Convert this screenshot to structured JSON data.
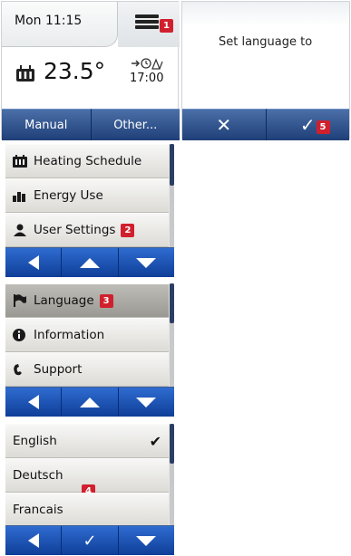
{
  "home": {
    "clock": "Mon 11:15",
    "temperature": "23.5°",
    "next_time": "17:00",
    "badge": "1",
    "buttons": [
      "Manual",
      "Other..."
    ]
  },
  "set_language": {
    "prompt": "Set language to",
    "cancel_symbol": "✕",
    "confirm_symbol": "✓",
    "badge": "5"
  },
  "main_menu": {
    "items": [
      {
        "label": "Heating Schedule",
        "icon": "calendar-icon"
      },
      {
        "label": "Energy Use",
        "icon": "bar-chart-icon"
      },
      {
        "label": "User Settings",
        "icon": "user-icon",
        "badge": "2"
      }
    ]
  },
  "settings_menu": {
    "items": [
      {
        "label": "Language",
        "icon": "flag-icon",
        "badge": "3"
      },
      {
        "label": "Information",
        "icon": "info-icon"
      },
      {
        "label": "Support",
        "icon": "phone-icon"
      }
    ]
  },
  "language_menu": {
    "items": [
      {
        "label": "English",
        "checked": true
      },
      {
        "label": "Deutsch"
      },
      {
        "label": "Francais"
      }
    ],
    "badge": "4",
    "confirm_symbol": "✓"
  },
  "colors": {
    "accent_blue": "#1f4fa8",
    "badge_red": "#d0202e",
    "menu_gray": "#dcdbd6"
  }
}
